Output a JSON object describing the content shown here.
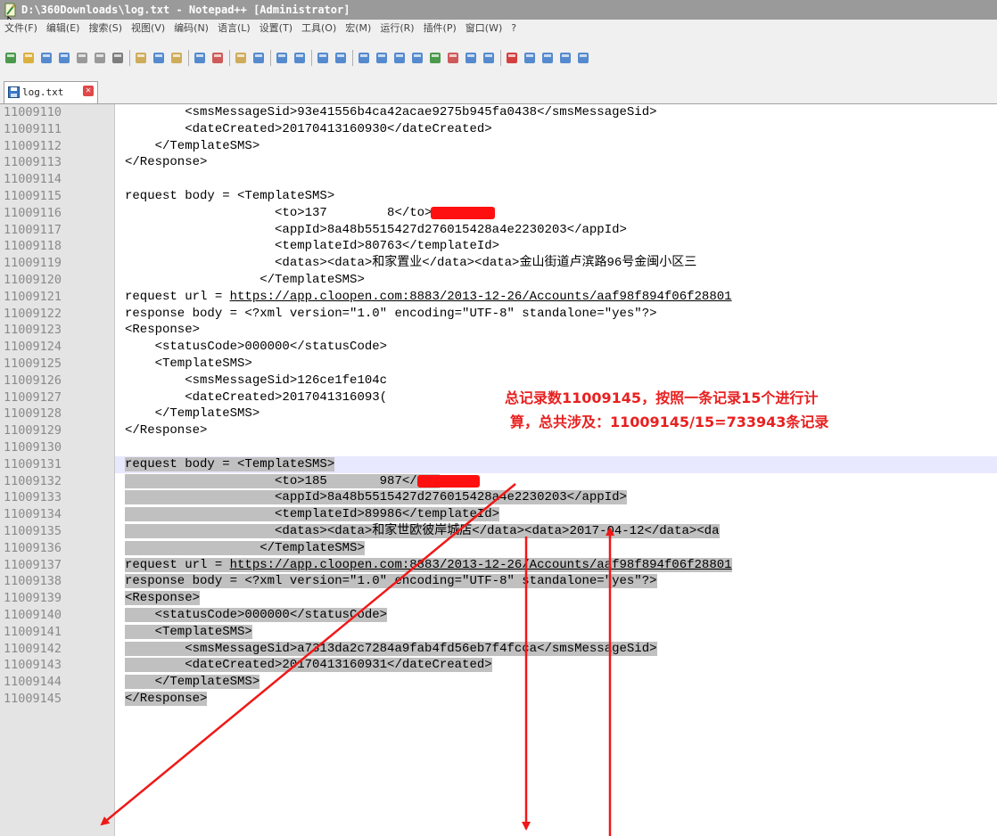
{
  "window": {
    "title": "D:\\360Downloads\\log.txt - Notepad++ [Administrator]"
  },
  "menu": [
    "文件(F)",
    "编辑(E)",
    "搜索(S)",
    "视图(V)",
    "编码(N)",
    "语言(L)",
    "设置(T)",
    "工具(O)",
    "宏(M)",
    "运行(R)",
    "插件(P)",
    "窗口(W)",
    "?"
  ],
  "toolbar": {
    "buttons": [
      "new",
      "open",
      "save",
      "save-all",
      "close",
      "close-all",
      "print",
      "cut",
      "copy",
      "paste",
      "undo",
      "redo",
      "find",
      "replace",
      "zoom-in",
      "zoom-out",
      "sync-v",
      "sync-h",
      "word-wrap",
      "show-all",
      "indent-guide",
      "udl",
      "doc-map",
      "function-list",
      "folder-workspace",
      "monitor",
      "record-macro",
      "stop-record",
      "play-macro",
      "run-macro-multiple",
      "save-macro"
    ]
  },
  "tab": {
    "label": "log.txt"
  },
  "lines": [
    {
      "num": "11009110",
      "text": "        <smsMessageSid>93e41556b4ca42acae9275b945fa0438</smsMessageSid>"
    },
    {
      "num": "11009111",
      "text": "        <dateCreated>20170413160930</dateCreated>"
    },
    {
      "num": "11009112",
      "text": "    </TemplateSMS>"
    },
    {
      "num": "11009113",
      "text": "</Response>"
    },
    {
      "num": "11009114",
      "text": ""
    },
    {
      "num": "11009115",
      "text": "request body = <TemplateSMS>"
    },
    {
      "num": "11009116",
      "text": "                    <to>137        8</to>"
    },
    {
      "num": "11009117",
      "text": "                    <appId>8a48b5515427d276015428a4e2230203</appId>"
    },
    {
      "num": "11009118",
      "text": "                    <templateId>80763</templateId>"
    },
    {
      "num": "11009119",
      "text": "                    <datas><data>和家置业</data><data>金山街道卢滨路96号金闽小区三"
    },
    {
      "num": "11009120",
      "text": "                  </TemplateSMS>"
    },
    {
      "num": "11009121",
      "text": "request url = https://app.cloopen.com:8883/2013-12-26/Accounts/aaf98f894f06f28801"
    },
    {
      "num": "11009122",
      "text": "response body = <?xml version=\"1.0\" encoding=\"UTF-8\" standalone=\"yes\"?>"
    },
    {
      "num": "11009123",
      "text": "<Response>"
    },
    {
      "num": "11009124",
      "text": "    <statusCode>000000</statusCode>"
    },
    {
      "num": "11009125",
      "text": "    <TemplateSMS>"
    },
    {
      "num": "11009126",
      "text": "        <smsMessageSid>126ce1fe104c"
    },
    {
      "num": "11009127",
      "text": "        <dateCreated>2017041316093("
    },
    {
      "num": "11009128",
      "text": "    </TemplateSMS>"
    },
    {
      "num": "11009129",
      "text": "</Response>"
    },
    {
      "num": "11009130",
      "text": ""
    },
    {
      "num": "11009131",
      "text": "request body = <TemplateSMS>"
    },
    {
      "num": "11009132",
      "text": "                    <to>185       987</to>"
    },
    {
      "num": "11009133",
      "text": "                    <appId>8a48b5515427d276015428a4e2230203</appId>"
    },
    {
      "num": "11009134",
      "text": "                    <templateId>89986</templateId>"
    },
    {
      "num": "11009135",
      "text": "                    <datas><data>和家世欧彼岸城店</data><data>2017-04-12</data><da"
    },
    {
      "num": "11009136",
      "text": "                  </TemplateSMS>"
    },
    {
      "num": "11009137",
      "text": "request url = https://app.cloopen.com:8883/2013-12-26/Accounts/aaf98f894f06f28801"
    },
    {
      "num": "11009138",
      "text": "response body = <?xml version=\"1.0\" encoding=\"UTF-8\" standalone=\"yes\"?>"
    },
    {
      "num": "11009139",
      "text": "<Response>"
    },
    {
      "num": "11009140",
      "text": "    <statusCode>000000</statusCode>"
    },
    {
      "num": "11009141",
      "text": "    <TemplateSMS>"
    },
    {
      "num": "11009142",
      "text": "        <smsMessageSid>a7313da2c7284a9fab4fd56eb7f4fcca</smsMessageSid>"
    },
    {
      "num": "11009143",
      "text": "        <dateCreated>20170413160931</dateCreated>"
    },
    {
      "num": "11009144",
      "text": "    </TemplateSMS>"
    },
    {
      "num": "11009145",
      "text": "</Response>"
    }
  ],
  "annotation": {
    "line1": "总记录数11009145，按照一条记录15个进行计",
    "line2": "算，总共涉及：11009145/15=733943条记录",
    "color": "#e82020"
  },
  "colors": {
    "selection": "#c0c0c0",
    "gutter": "#e4e4e4",
    "line_number": "#8a8a8a",
    "caret_line": "#e8e8ff",
    "title_bar": "#9a9a9a"
  }
}
